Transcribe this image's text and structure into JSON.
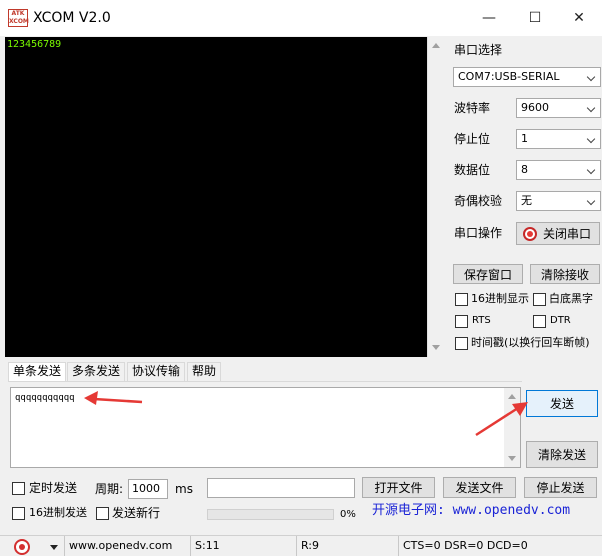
{
  "window": {
    "logo_text": "ATK XCOM",
    "title": "XCOM V2.0",
    "min_glyph": "—",
    "max_glyph": "☐",
    "close_glyph": "✕"
  },
  "terminal": {
    "received_text": "123456789",
    "text_color": "#7cfc00"
  },
  "settings": {
    "port_label": "串口选择",
    "port_value": "COM7:USB-SERIAL",
    "baud_label": "波特率",
    "baud_value": "9600",
    "stop_label": "停止位",
    "stop_value": "1",
    "data_label": "数据位",
    "data_value": "8",
    "parity_label": "奇偶校验",
    "parity_value": "无",
    "op_label": "串口操作",
    "op_button": "关闭串口",
    "save_window": "保存窗口",
    "clear_receive": "清除接收",
    "hex_display": "16进制显示",
    "white_bg": "白底黑字",
    "rts": "RTS",
    "dtr": "DTR",
    "timestamp": "时间戳(以换行回车断帧)"
  },
  "tabs": [
    "单条发送",
    "多条发送",
    "协议传输",
    "帮助"
  ],
  "send": {
    "text": "qqqqqqqqqqq",
    "send_button": "发送",
    "clear_send_button": "清除发送"
  },
  "bottom": {
    "timed_send": "定时发送",
    "period_label": "周期:",
    "period_value": "1000",
    "period_unit": "ms",
    "open_file": "打开文件",
    "send_file": "发送文件",
    "stop_send": "停止发送",
    "hex_send": "16进制发送",
    "send_newline": "发送新行",
    "progress_percent": "0%",
    "progress_value": 0,
    "url_banner": "开源电子网: www.openedv.com"
  },
  "status": {
    "website": "www.openedv.com",
    "sent": "S:11",
    "received": "R:9",
    "lines": "CTS=0 DSR=0 DCD=0"
  }
}
